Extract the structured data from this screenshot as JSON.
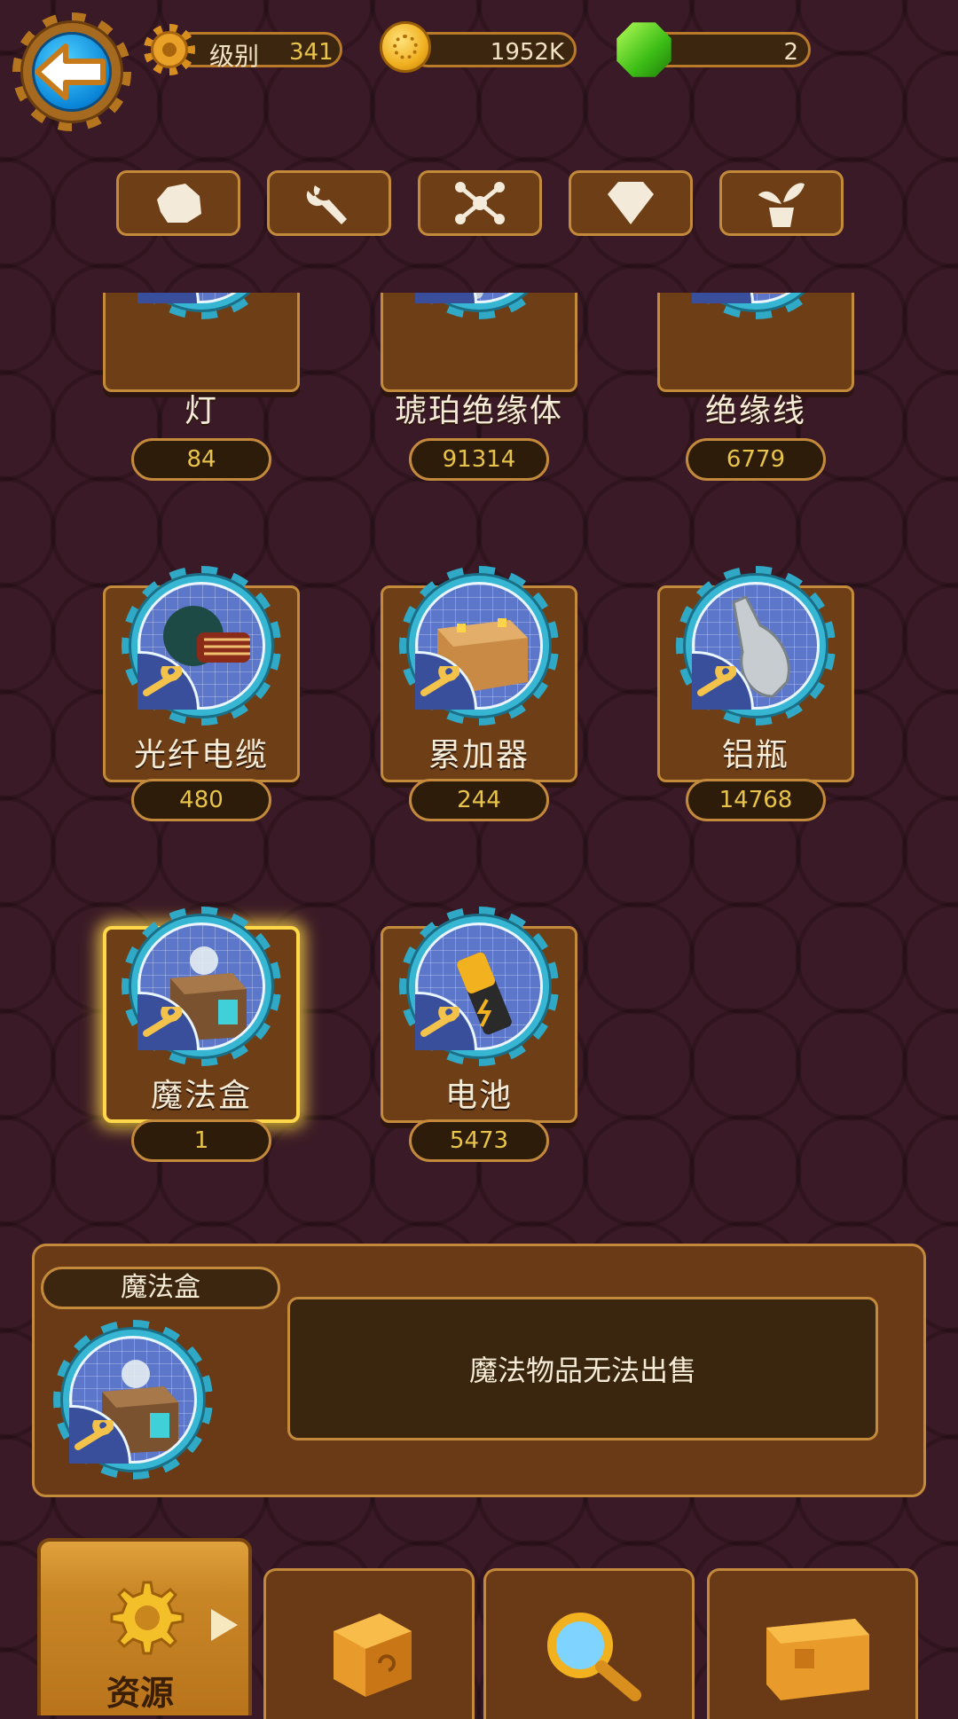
{
  "header": {
    "level_label": "级别",
    "level_value": "341",
    "coins": "1952K",
    "gems": "2",
    "icons": {
      "back": "back-arrow-icon",
      "level": "gear-icon",
      "coins": "gold-coin-icon",
      "gems": "green-gem-icon"
    }
  },
  "category_tabs": [
    {
      "icon": "stone-icon"
    },
    {
      "icon": "wrench-icon"
    },
    {
      "icon": "molecule-icon"
    },
    {
      "icon": "diamond-icon"
    },
    {
      "icon": "plant-icon"
    }
  ],
  "items": [
    {
      "name": "灯",
      "count": "84",
      "icon": "light-bulb-icon"
    },
    {
      "name": "琥珀绝缘体",
      "count": "91314",
      "icon": "amber-insulator-icon"
    },
    {
      "name": "绝缘线",
      "count": "6779",
      "icon": "insulated-wire-icon"
    },
    {
      "name": "光纤电缆",
      "count": "480",
      "icon": "fiber-cable-icon"
    },
    {
      "name": "累加器",
      "count": "244",
      "icon": "accumulator-icon"
    },
    {
      "name": "铝瓶",
      "count": "14768",
      "icon": "aluminum-bottle-icon"
    },
    {
      "name": "魔法盒",
      "count": "1",
      "icon": "magic-box-icon",
      "selected": true
    },
    {
      "name": "电池",
      "count": "5473",
      "icon": "battery-icon"
    }
  ],
  "detail": {
    "name": "魔法盒",
    "description": "魔法物品无法出售",
    "icon": "magic-box-icon"
  },
  "bottom_nav": [
    {
      "label": "资源",
      "icon": "gear-icon",
      "active": true
    },
    {
      "label": "",
      "icon": "dice-cube-icon"
    },
    {
      "label": "",
      "icon": "magnifier-icon"
    },
    {
      "label": "",
      "icon": "treasure-chest-icon"
    }
  ]
}
